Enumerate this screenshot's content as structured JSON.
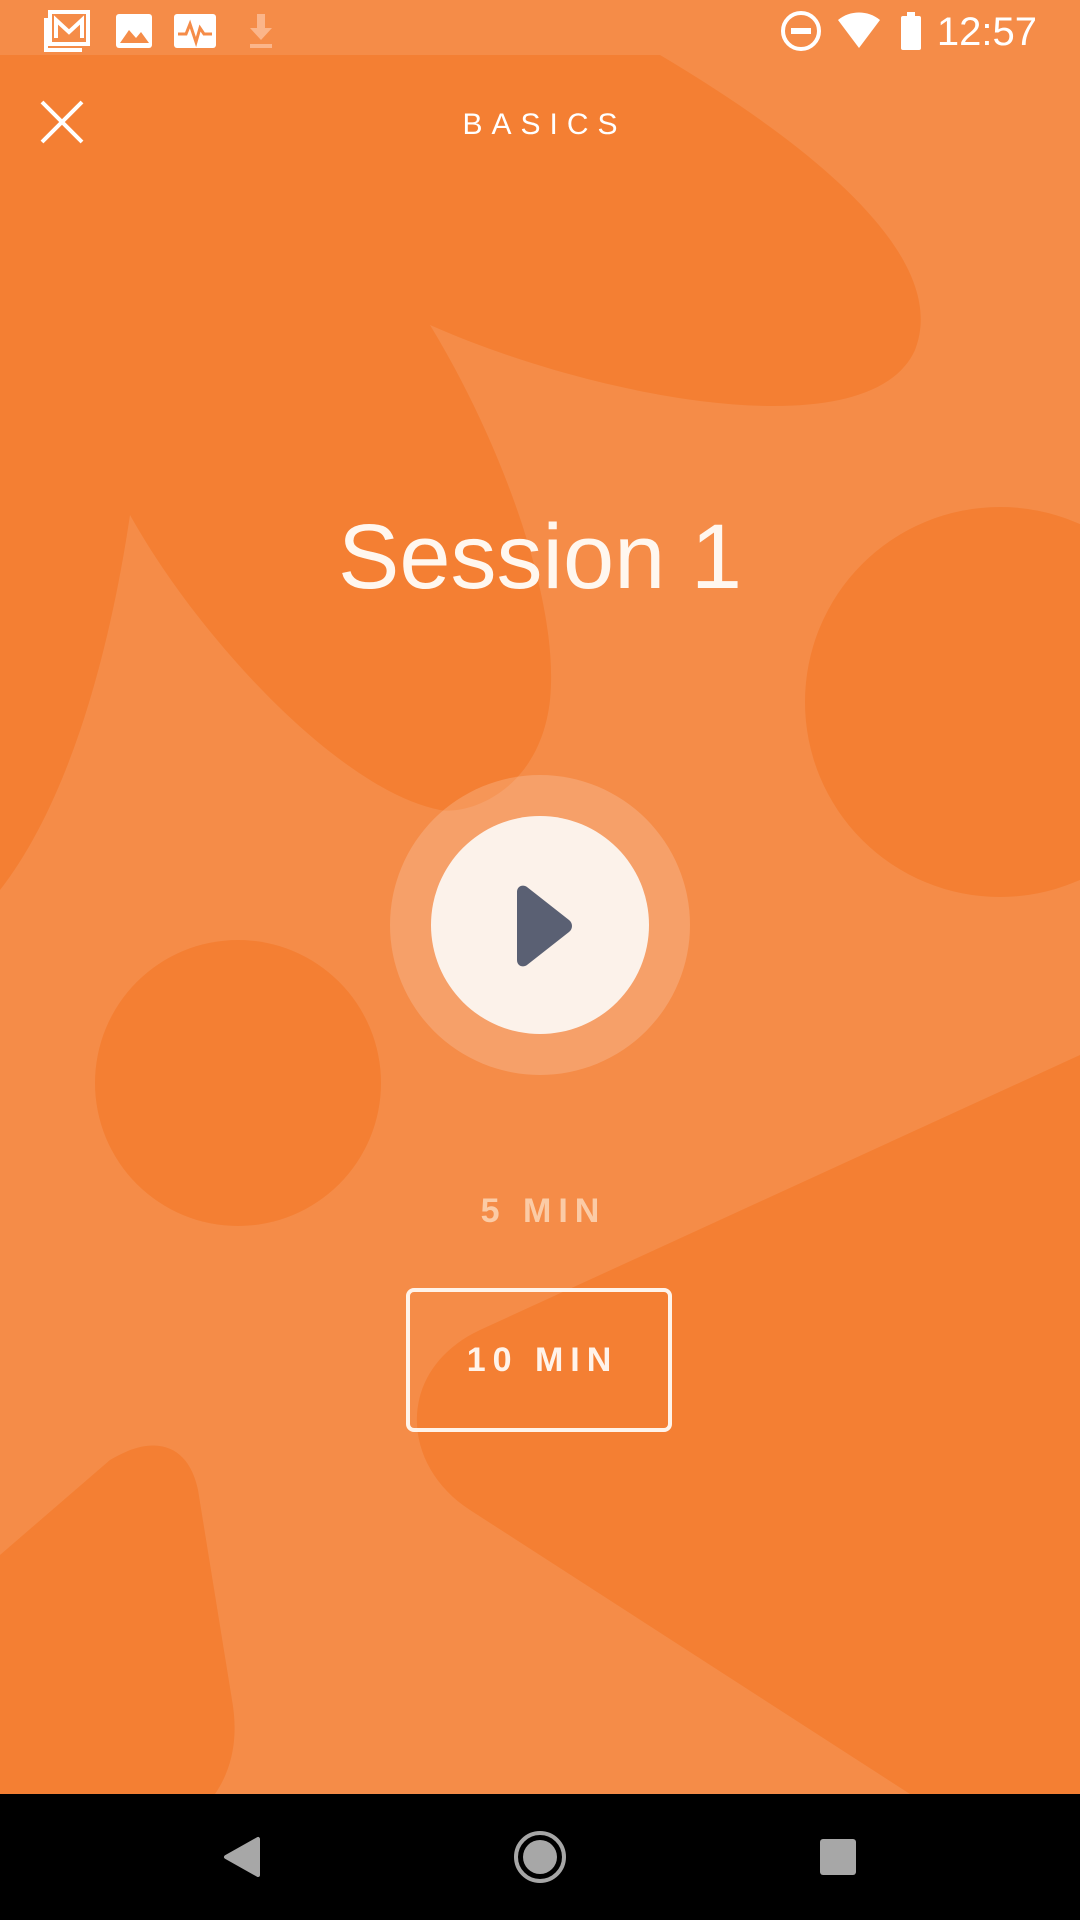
{
  "theme": {
    "background": "#F58C48",
    "shape_color": "#F47F33",
    "accent_light": "#FCF2EA",
    "play_icon_color": "#5A6073"
  },
  "status_bar": {
    "time": "12:57",
    "left_icons": [
      "gmail-icon",
      "gallery-icon",
      "activity-icon",
      "download-icon"
    ],
    "right_icons": [
      "do-not-disturb-icon",
      "wifi-icon",
      "battery-icon"
    ]
  },
  "header": {
    "title": "BASICS",
    "close_icon": "close-icon"
  },
  "session": {
    "title": "Session 1"
  },
  "player": {
    "play_icon": "play-icon"
  },
  "durations": {
    "option_5": "5 MIN",
    "option_10": "10 MIN",
    "selected": "10 MIN"
  },
  "nav_bar": {
    "icons": [
      "back-icon",
      "home-icon",
      "recents-icon"
    ]
  }
}
